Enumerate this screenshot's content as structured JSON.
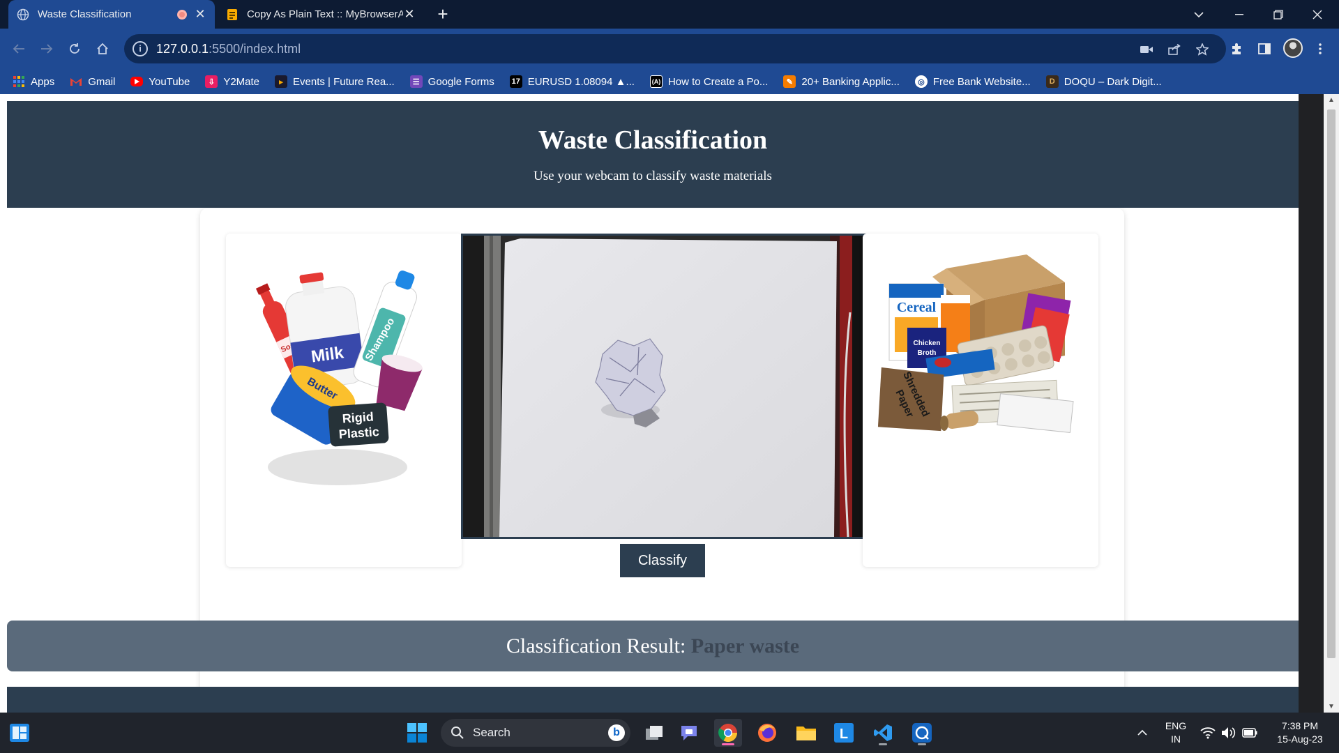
{
  "browser": {
    "tabs": [
      {
        "title": "Waste Classification",
        "active": true
      },
      {
        "title": "Copy As Plain Text :: MyBrowserA",
        "active": false
      }
    ],
    "new_tab_symbol": "+",
    "close_symbol": "✕",
    "url_host": "127.0.0.1",
    "url_rest": ":5500/index.html",
    "bookmarks": [
      {
        "label": "Apps",
        "icon": "apps-grid-icon"
      },
      {
        "label": "Gmail",
        "icon": "gmail-icon"
      },
      {
        "label": "YouTube",
        "icon": "youtube-icon"
      },
      {
        "label": "Y2Mate",
        "icon": "download-icon"
      },
      {
        "label": "Events | Future Rea...",
        "icon": "events-icon"
      },
      {
        "label": "Google Forms",
        "icon": "google-forms-icon"
      },
      {
        "label": "EURUSD 1.08094 ▲...",
        "icon": "tradingview-icon"
      },
      {
        "label": "How to Create a Po...",
        "icon": "code-icon"
      },
      {
        "label": "20+ Banking Applic...",
        "icon": "pen-icon"
      },
      {
        "label": "Free Bank Website...",
        "icon": "globe-icon"
      },
      {
        "label": "DOQU – Dark Digit...",
        "icon": "doqu-icon"
      }
    ]
  },
  "page": {
    "title": "Waste Classification",
    "subtitle": "Use your webcam to classify waste materials",
    "classify_button": "Classify",
    "result_label": "Classification Result:",
    "result_value": "Paper waste",
    "left_image_labels": {
      "soda": "Soda",
      "milk": "Milk",
      "shampoo": "Shampoo",
      "butter": "Butter",
      "rigid": "Rigid",
      "plastic": "Plastic"
    },
    "right_image_labels": {
      "cereal": "Cereal",
      "chicken": "Chicken",
      "broth": "Broth",
      "shredded": "Shredded",
      "paper": "Paper"
    }
  },
  "taskbar": {
    "search_placeholder": "Search",
    "language": "ENG",
    "region": "IN",
    "time": "7:38 PM",
    "date": "15-Aug-23"
  },
  "colors": {
    "header_bg": "#2c3e50",
    "result_bg": "#5a6a7b",
    "browser_accent": "#1f4a93"
  }
}
